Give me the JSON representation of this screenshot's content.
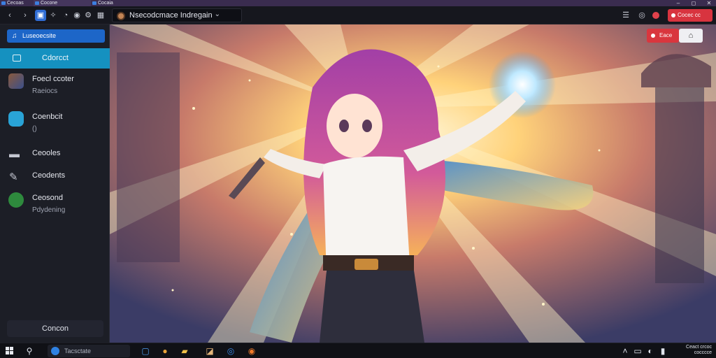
{
  "tabs": [
    {
      "label": "Cecoas"
    },
    {
      "label": "Cocone"
    },
    {
      "label": "Cocaia"
    }
  ],
  "window_controls": {
    "minimize": "–",
    "maximize": "◻",
    "close": "✕"
  },
  "toolbar": {
    "address_text": "Nsecodcmace Indregain",
    "record_label": "Cocec cc",
    "chevron": "⌄"
  },
  "sidebar": {
    "search_label": "Luseoecsite",
    "active_channel": "Cdorcct",
    "items": [
      {
        "label": "Foecl ccoter",
        "sub": "Raeiocs",
        "icon": "avatar-icon"
      },
      {
        "label": "Coenbcit",
        "sub": "()",
        "icon": "discord-icon"
      },
      {
        "label": "Ceooles",
        "sub": "",
        "icon": "gamepad-icon"
      },
      {
        "label": "Ceodents",
        "sub": "",
        "icon": "pin-icon"
      },
      {
        "label": "Ceosond",
        "sub": "Pdydening",
        "icon": "xbox-icon"
      }
    ],
    "connect_label": "Concon"
  },
  "stage": {
    "live_label": "Eace",
    "share_glyph": "⌂"
  },
  "taskbar": {
    "search_text": "Tacsctate",
    "clock_line1": "Ceact crcoc",
    "clock_line2": "cocccce"
  },
  "colors": {
    "accent_blue": "#1d66c8",
    "channel_teal": "#1591c0",
    "live_red": "#d9363e",
    "sidebar_bg": "#1c1e26"
  }
}
